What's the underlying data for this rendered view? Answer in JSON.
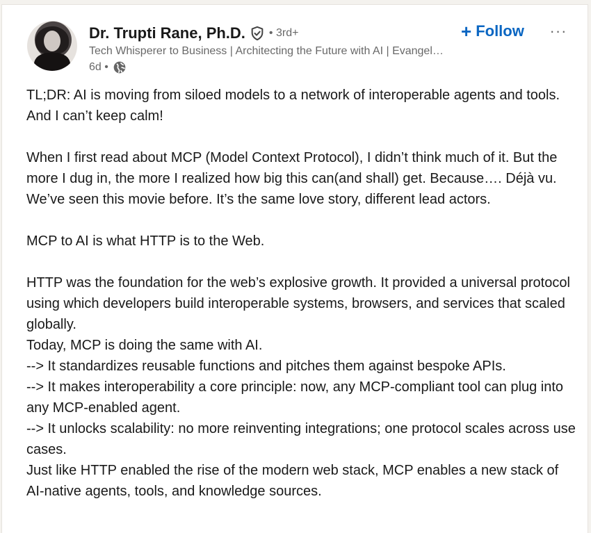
{
  "author": {
    "name": "Dr. Trupti Rane, Ph.D.",
    "degree": "• 3rd+",
    "headline": "Tech Whisperer to Business | Architecting the Future with AI | Evangelizing Agentic Systems",
    "time": "6d •"
  },
  "actions": {
    "follow_label": "Follow",
    "follow_plus": "+",
    "more_label": "···"
  },
  "post": {
    "lines": [
      "TL;DR: AI is moving from siloed models to a network of interoperable agents and tools. And I can’t keep calm!",
      "",
      "When I first read about MCP (Model Context Protocol), I didn’t think much of it. But the more I dug in, the more I realized how big this can(and shall) get. Because…. Déjà vu. We’ve seen this movie before. It’s the same love story, different lead actors.",
      "",
      "MCP to AI is what HTTP is to the Web.",
      "",
      "HTTP was the foundation for the web’s explosive growth. It provided a universal protocol using which developers build interoperable systems, browsers, and services that scaled globally.",
      "Today, MCP is doing the same with AI.",
      "--> It standardizes reusable functions and pitches them against bespoke APIs.",
      "--> It makes interoperability a core principle: now, any MCP-compliant tool can plug into any MCP-enabled agent.",
      "--> It unlocks scalability: no more reinventing integrations; one protocol scales across use cases.",
      "Just like HTTP enabled the rise of the modern web stack, MCP enables a new stack of AI-native agents, tools, and knowledge sources."
    ]
  },
  "colors": {
    "accent": "#0a66c2",
    "text_primary": "#191919",
    "text_secondary": "#666666"
  }
}
